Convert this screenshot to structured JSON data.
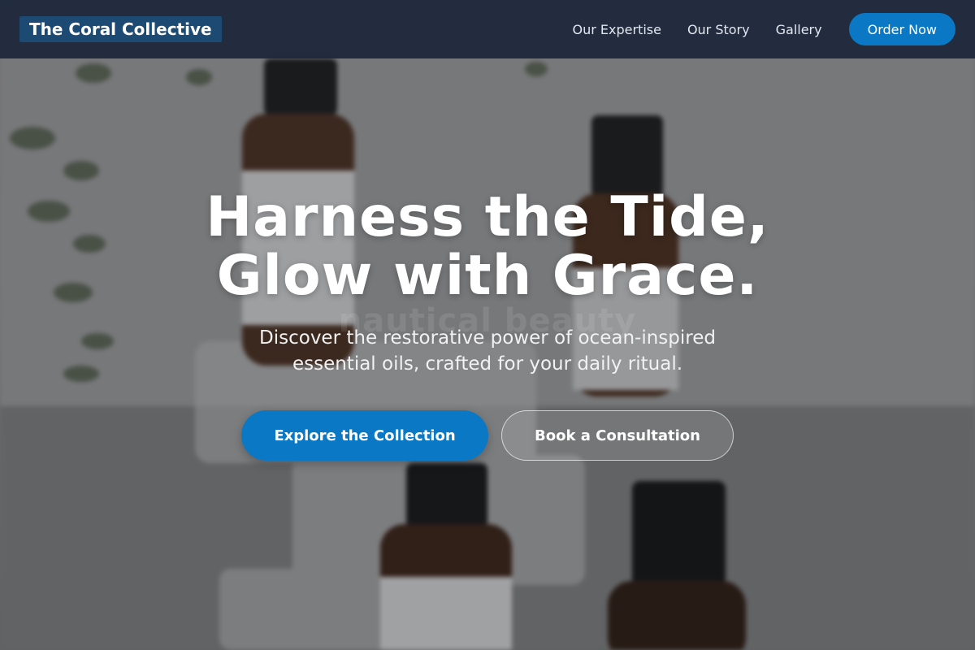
{
  "nav": {
    "brand": "The Coral Collective",
    "links": [
      "Our Expertise",
      "Our Story",
      "Gallery"
    ],
    "order_label": "Order Now"
  },
  "hero": {
    "headline_line1": "Harness the Tide,",
    "headline_line2": "Glow with Grace.",
    "watermark": "nautical beauty",
    "subhead_line1": "Discover the restorative power of ocean-inspired",
    "subhead_line2": "essential oils, crafted for your daily ritual.",
    "primary_cta": "Explore the Collection",
    "secondary_cta": "Book a Consultation"
  },
  "background": {
    "image": "blurred-amber-essential-oil-bottles"
  },
  "colors": {
    "nav_bg": "#1e293b",
    "brand_bg": "#1d4a73",
    "accent": "#0a78c4",
    "text": "#ffffff"
  }
}
